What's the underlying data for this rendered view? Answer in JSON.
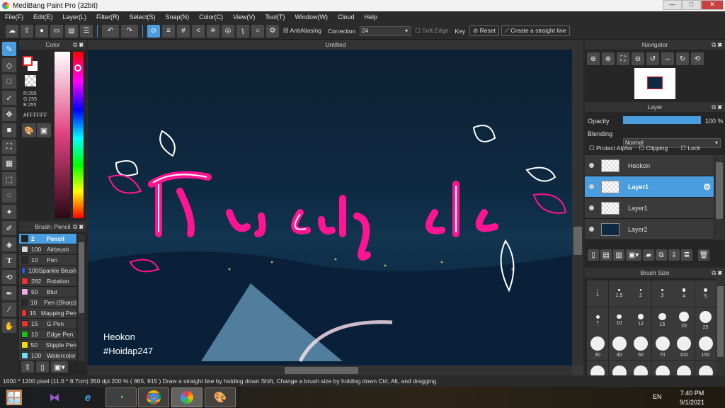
{
  "window": {
    "title": "MediBang Paint Pro (32bit)",
    "minimize": "—",
    "maximize": "□",
    "close": "✕"
  },
  "menu": [
    "File(F)",
    "Edit(E)",
    "Layer(L)",
    "Filter(R)",
    "Select(S)",
    "Snap(N)",
    "Color(C)",
    "View(V)",
    "Tool(T)",
    "Window(W)",
    "Cloud",
    "Help"
  ],
  "toolbar": {
    "antialiasing": "AntiAliasing",
    "correction_label": "Correction",
    "correction_value": "24",
    "soft_edge": "Soft Edge",
    "key": "Key",
    "reset": "Reset",
    "straight_line": "Create a straight line"
  },
  "color_panel": {
    "title": "Color",
    "r": "R:255",
    "g": "G:255",
    "b": "B:255",
    "hex": "#FFFFFF"
  },
  "brush_panel": {
    "title": "Brush: Pencil",
    "items": [
      {
        "size": "2",
        "name": "Pencil",
        "color": "#222222"
      },
      {
        "size": "100",
        "name": "Airbrush",
        "color": "#d8d8d8"
      },
      {
        "size": "10",
        "name": "Pen",
        "color": "#2a2a2a"
      },
      {
        "size": "100",
        "name": "Sparkle Brush",
        "color": "#3355ee"
      },
      {
        "size": "282",
        "name": "Rotation",
        "color": "#ee3333"
      },
      {
        "size": "50",
        "name": "Blur",
        "color": "#f0a8f0"
      },
      {
        "size": "10",
        "name": "Pen (Sharp)",
        "color": "#2a2a2a"
      },
      {
        "size": "15",
        "name": "Mapping Pen",
        "color": "#ee3333"
      },
      {
        "size": "15",
        "name": "G Pen",
        "color": "#ee3333"
      },
      {
        "size": "10",
        "name": "Edge Pen",
        "color": "#22bb22"
      },
      {
        "size": "50",
        "name": "Stipple Pen",
        "color": "#eedd11"
      },
      {
        "size": "100",
        "name": "Watercolor",
        "color": "#77ddf5"
      }
    ]
  },
  "canvas": {
    "tab": "Untitled",
    "text1": "Heokon",
    "text2": "#Hoidap247"
  },
  "navigator": {
    "title": "Navigator"
  },
  "layer_panel": {
    "title": "Layer",
    "opacity_label": "Opacity",
    "opacity_value": "100 %",
    "opacity_fraction": 1.0,
    "blending_label": "Blending",
    "blending_value": "Normal",
    "protect_alpha": "Protect Alpha",
    "clipping": "Clipping",
    "lock": "Lock",
    "layers": [
      {
        "name": "Heokon",
        "selected": false
      },
      {
        "name": "Layer1",
        "selected": true
      },
      {
        "name": "Layer1",
        "selected": false
      },
      {
        "name": "Layer2",
        "selected": false
      }
    ]
  },
  "brush_size": {
    "title": "Brush Size",
    "sizes": [
      "1",
      "1.5",
      "2",
      "3",
      "4",
      "5",
      "7",
      "10",
      "12",
      "15",
      "20",
      "25",
      "30",
      "40",
      "50",
      "70",
      "100",
      "150"
    ]
  },
  "status": "1600 * 1200 pixel   (11.6 * 8.7cm)   350 dpi   200 %   ( 865, 915 )   Draw a straight line by holding down Shift, Change a brush size by holding down Ctrl, Alt, and dragging",
  "taskbar": {
    "lang": "EN",
    "time": "7:40 PM",
    "date": "9/1/2021"
  }
}
